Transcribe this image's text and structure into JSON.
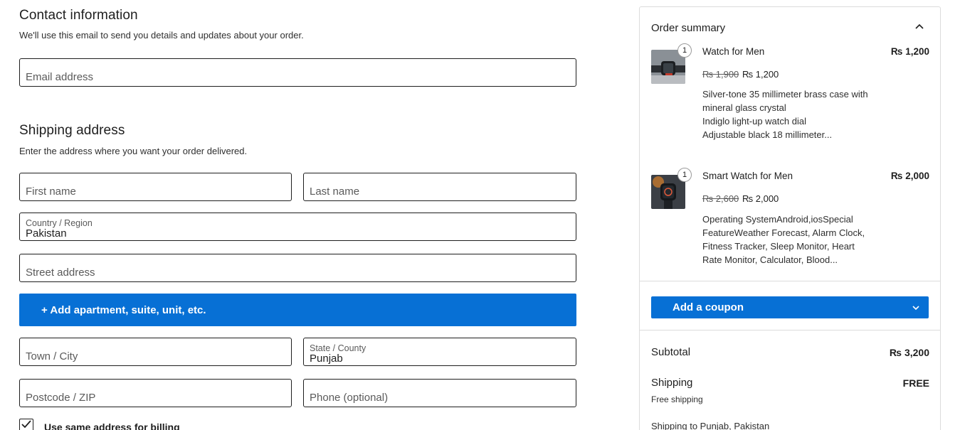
{
  "contact": {
    "heading": "Contact information",
    "description": "We'll use this email to send you details and updates about your order.",
    "email_placeholder": "Email address"
  },
  "shipping": {
    "heading": "Shipping address",
    "description": "Enter the address where you want your order delivered.",
    "first_name_placeholder": "First name",
    "last_name_placeholder": "Last name",
    "country_label": "Country / Region",
    "country_value": "Pakistan",
    "street_placeholder": "Street address",
    "add_apartment_label": "+ Add apartment, suite, unit, etc.",
    "city_placeholder": "Town / City",
    "state_label": "State / County",
    "state_value": "Punjab",
    "postcode_placeholder": "Postcode / ZIP",
    "phone_placeholder": "Phone (optional)",
    "same_billing_label": "Use same address for billing",
    "same_billing_checked": true
  },
  "summary": {
    "title": "Order summary",
    "items": [
      {
        "quantity": "1",
        "name": "Watch for Men",
        "price": "₨ 1,200",
        "old_price": "₨ 1,900",
        "new_price": "₨ 1,200",
        "description_lines": [
          "Silver-tone 35 millimeter brass case with",
          "mineral glass crystal",
          "Indiglo light-up watch dial",
          "Adjustable black 18 millimeter..."
        ]
      },
      {
        "quantity": "1",
        "name": "Smart Watch for Men",
        "price": "₨ 2,000",
        "old_price": "₨ 2,600",
        "new_price": "₨ 2,000",
        "description_lines": [
          "Operating SystemAndroid,iosSpecial",
          "FeatureWeather Forecast, Alarm Clock,",
          "Fitness Tracker, Sleep Monitor, Heart",
          "Rate Monitor, Calculator, Blood..."
        ]
      }
    ],
    "coupon_label": "Add a coupon",
    "subtotal_label": "Subtotal",
    "subtotal_value": "₨ 3,200",
    "shipping_label": "Shipping",
    "shipping_value": "FREE",
    "shipping_method": "Free shipping",
    "shipping_to": "Shipping to Punjab, Pakistan"
  },
  "colors": {
    "accent": "#0770d5",
    "border": "#1e1e1e",
    "panel_border": "#dcdcdc"
  },
  "icons": [
    "chevron-up-icon",
    "chevron-down-icon",
    "checkmark-icon"
  ]
}
